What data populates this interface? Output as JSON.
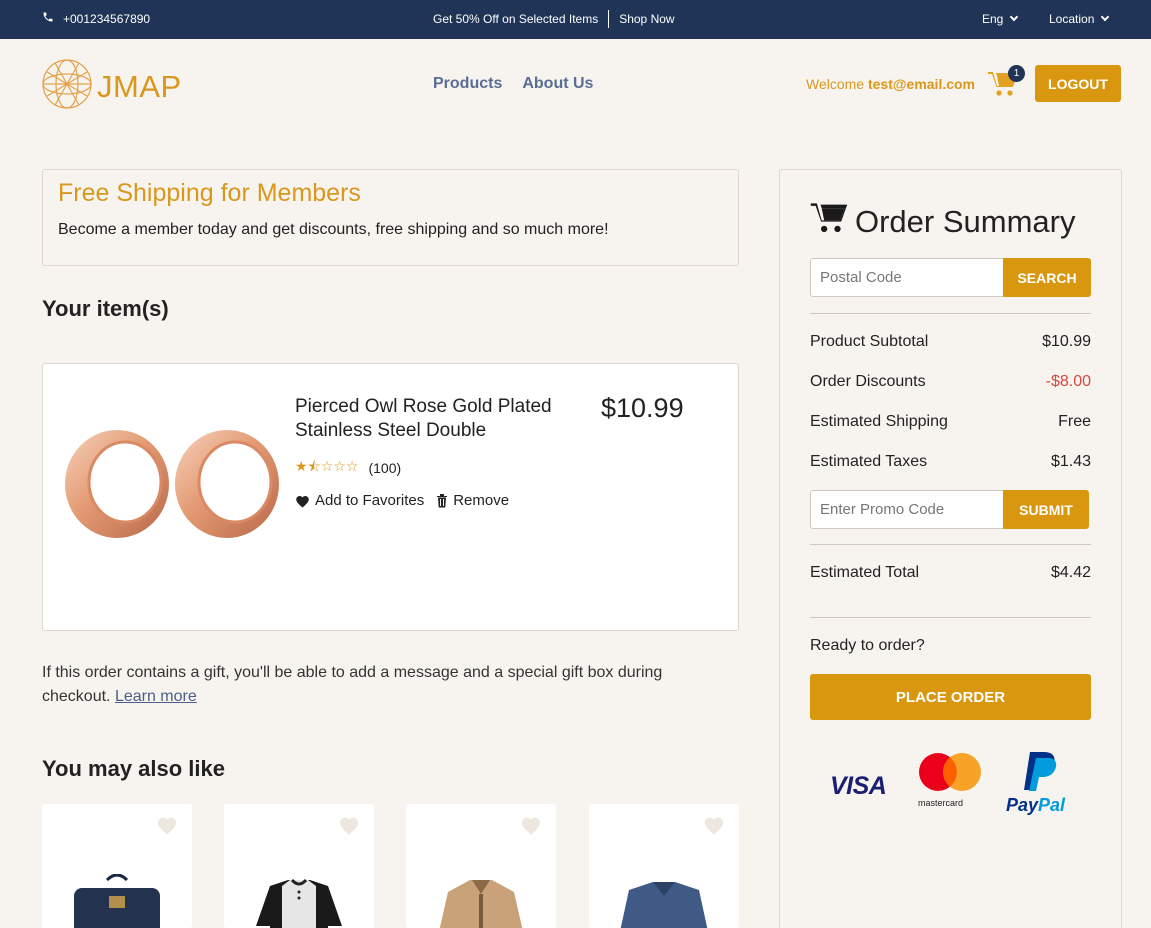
{
  "topbar": {
    "phone": "+001234567890",
    "promo_text": "Get 50% Off on Selected Items",
    "promo_link": "Shop Now",
    "language": "Eng",
    "location": "Location"
  },
  "header": {
    "brand": "JMAP",
    "nav": [
      "Products",
      "About Us"
    ],
    "welcome_prefix": "Welcome",
    "welcome_email": "test@email.com",
    "cart_count": "1",
    "logout_label": "LOGOUT"
  },
  "shipping_banner": {
    "title": "Free Shipping for Members",
    "text": "Become a member today and get discounts, free shipping and so much more!"
  },
  "items_heading": "Your item(s)",
  "cart_item": {
    "name": "Pierced Owl Rose Gold Plated Stainless Steel Double",
    "price": "$10.99",
    "rating_stars": "★⯪☆☆☆",
    "rating_value": 1.5,
    "review_count": "(100)",
    "favorite_label": "Add to Favorites",
    "remove_label": "Remove"
  },
  "gift_note": {
    "text": "If this order contains a gift, you'll be able to add a message and a special gift box during checkout.",
    "link": "Learn more"
  },
  "also_like_heading": "You may also like",
  "recommended_products": [
    "backpack",
    "henley-shirt",
    "jacket",
    "sweater"
  ],
  "summary": {
    "title": "Order Summary",
    "postal_placeholder": "Postal Code",
    "search_label": "SEARCH",
    "rows": [
      {
        "label": "Product Subtotal",
        "value": "$10.99"
      },
      {
        "label": "Order Discounts",
        "value": "-$8.00"
      },
      {
        "label": "Estimated Shipping",
        "value": "Free"
      },
      {
        "label": "Estimated Taxes",
        "value": "$1.43"
      }
    ],
    "promo_placeholder": "Enter Promo Code",
    "submit_label": "SUBMIT",
    "total_label": "Estimated Total",
    "total_value": "$4.42",
    "ready_text": "Ready to order?",
    "place_order_label": "PLACE ORDER",
    "payments": {
      "visa": "VISA",
      "mastercard": "mastercard",
      "paypal_a": "Pay",
      "paypal_b": "Pal"
    }
  },
  "colors": {
    "navy": "#1f3456",
    "accent": "#d9970f",
    "background": "#f7f4f0",
    "discount": "#d9473d",
    "nav_link": "#4a5f8a"
  }
}
